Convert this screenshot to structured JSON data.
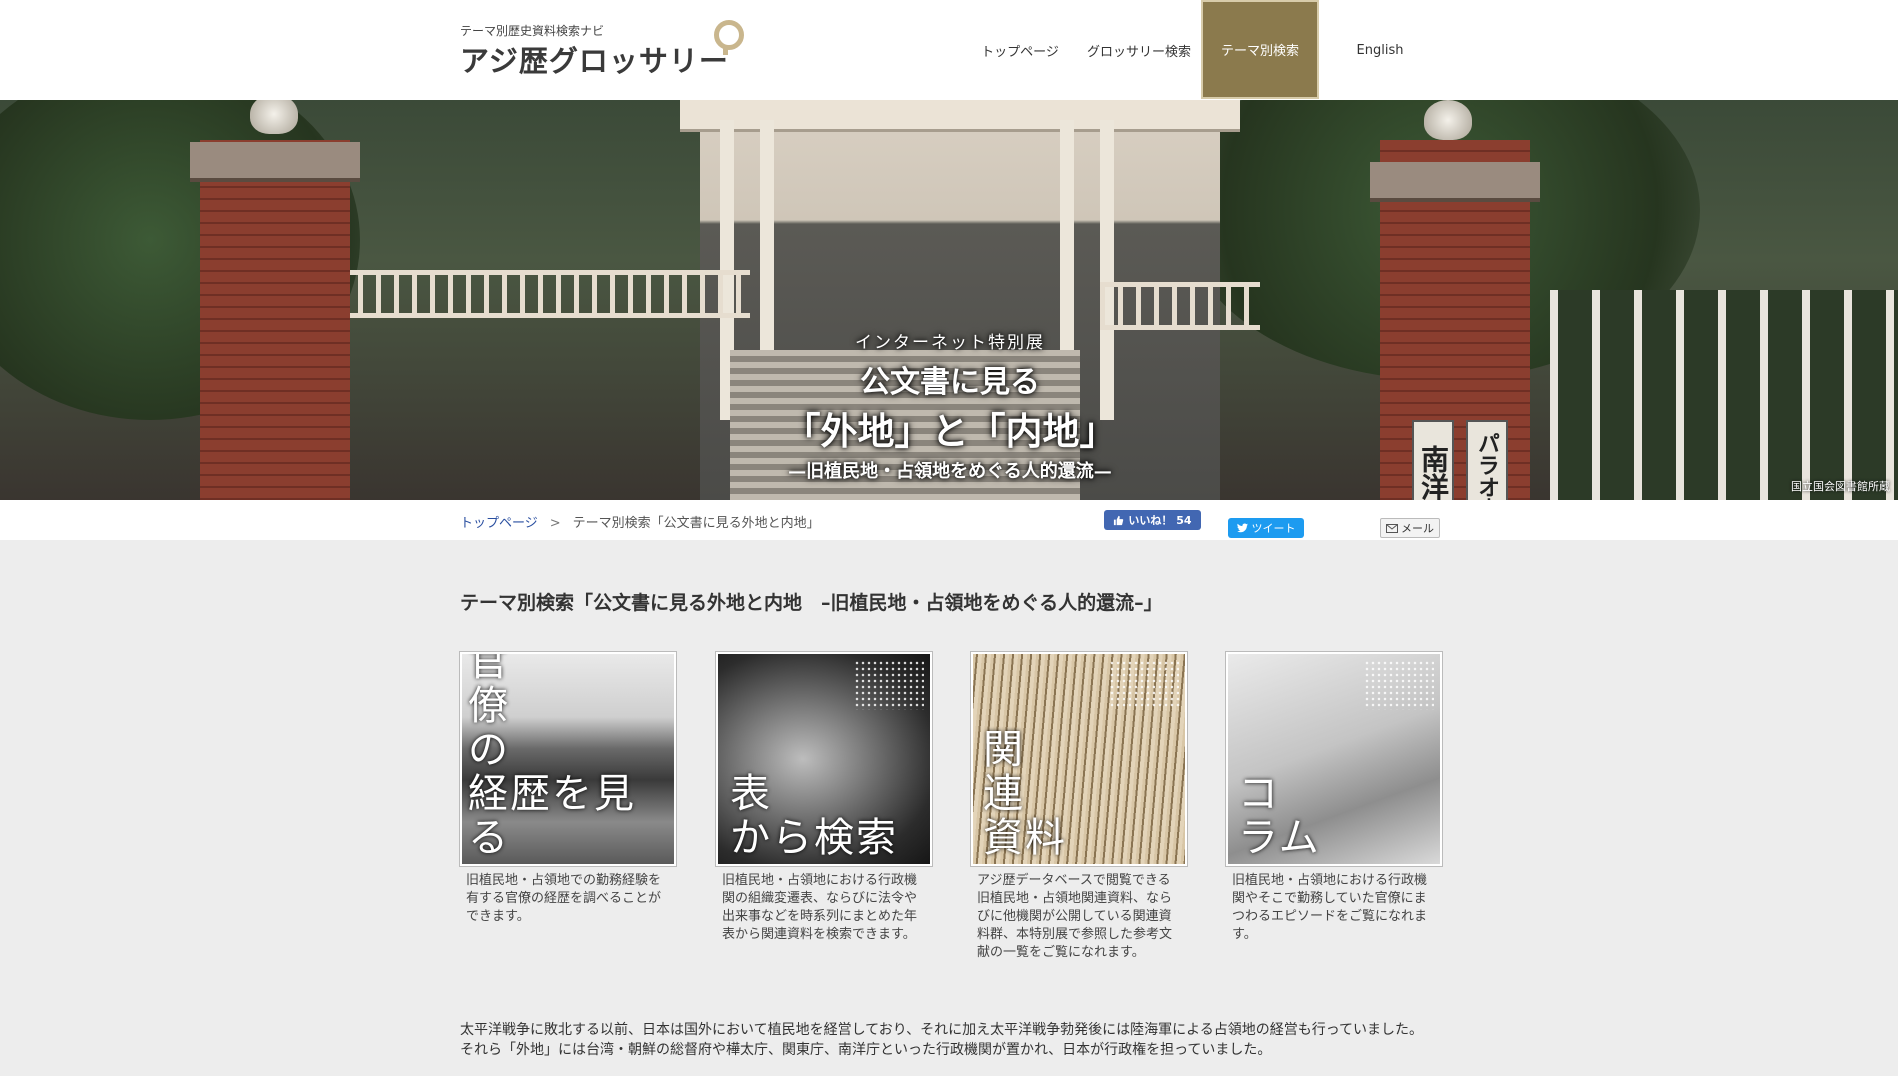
{
  "header": {
    "logo_sub": "テーマ別歴史資料検索ナビ",
    "logo_main": "アジ歴グロッサリー",
    "nav": [
      {
        "label": "トップページ"
      },
      {
        "label": "グロッサリー検索"
      },
      {
        "label": "テーマ別検索",
        "active": true
      },
      {
        "label": "English"
      }
    ]
  },
  "hero": {
    "kicker": "インターネット特別展",
    "title_line1": "公文書に見る",
    "title_line2": "「外地」と「内地」",
    "subtitle": "—旧植民地・占領地をめぐる人的還流—",
    "sign_left": "南洋廳",
    "sign_right": "パラオ支廳",
    "credit": "国立国会図書館所蔵"
  },
  "breadcrumb": {
    "home": "トップページ",
    "separator": ">",
    "current": "テーマ別検索「公文書に見る外地と内地」"
  },
  "social": {
    "like_label": "いいね！ 54",
    "tweet_label": "ツイート",
    "mail_label": "メール"
  },
  "main": {
    "title": "テーマ別検索「公文書に見る外地と内地　–旧植民地・占領地をめぐる人的還流–」",
    "cards": [
      {
        "label_l1": "官",
        "label_l2": "僚",
        "label_l3": "の",
        "label_l4": "経歴を見る",
        "desc": "旧植民地・占領地での勤務経験を有する官僚の経歴を調べることができます。"
      },
      {
        "label_l1": "表",
        "label_l2": "から検索",
        "desc": "旧植民地・占領地における行政機関の組織変遷表、ならびに法令や出来事などを時系列にまとめた年表から関連資料を検索できます。"
      },
      {
        "label_l1": "関",
        "label_l2": "連",
        "label_l3": "資料",
        "desc": "アジ歴データベースで閲覧できる旧植民地・占領地関連資料、ならびに他機関が公開している関連資料群、本特別展で参照した参考文献の一覧をご覧になれます。"
      },
      {
        "label_l1": "コ",
        "label_l2": "ラム",
        "desc": "旧植民地・占領地における行政機関やそこで勤務していた官僚にまつわるエピソードをご覧になれます。"
      }
    ],
    "intro_p1": "太平洋戦争に敗北する以前、日本は国外において植民地を経営しており、それに加え太平洋戦争勃発後には陸海軍による占領地の経営も行っていました。",
    "intro_p2": "それら「外地」には台湾・朝鮮の総督府や樺太庁、関東庁、南洋庁といった行政機関が置かれ、日本が行政権を担っていました。"
  },
  "colors": {
    "accent": "#8b7a4d",
    "logo_mark": "#c9b68d",
    "facebook": "#4267b2",
    "twitter": "#1d9bf0"
  }
}
